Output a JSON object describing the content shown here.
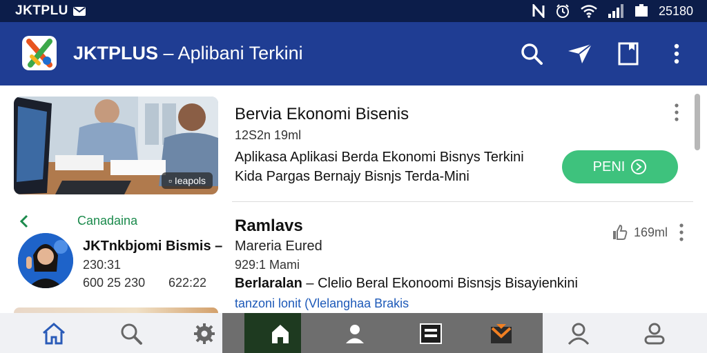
{
  "status_bar": {
    "carrier": "JKTPLU",
    "time": "25180"
  },
  "app_bar": {
    "title_bold": "JKTPLUS",
    "title_rest": " – Aplibani Terkini"
  },
  "card1": {
    "thumbnail_tag": "▫ Ieapols",
    "title": "Bervia  Ekonomi Bisenis",
    "meta": "12S2n 19ml",
    "description_line1": "Aplikasa Aplikasi Berda Ekonomi Bisnys Terkini",
    "description_line2": "Kida Pargas Bernajy Bisnjs Terda-Mini",
    "action_label": "PENI"
  },
  "left_panel": {
    "category": "Canadaina",
    "name": "JKTnkbjomi Bismis –",
    "time": "230:31",
    "number1": "600 25 230",
    "number2": "622:22"
  },
  "card2": {
    "title": "Ramlavs",
    "subtitle": "Mareria Eured",
    "meta": "929:1 Mami",
    "description_bold": "Berlaralan",
    "description_rest": " – Clelio Beral Ekonoomi Bisnsjs Bisayienkini",
    "link_text": "tanzoni lonit  (Vlelanghaa Brakis",
    "like_count": "169ml"
  },
  "icons": [
    "mail-icon",
    "nfc-icon",
    "alarm-icon",
    "wifi-icon",
    "signal-icon",
    "battery-icon",
    "search-icon",
    "send-icon",
    "bookmark-icon",
    "more-vert-icon",
    "home-icon",
    "settings-icon",
    "person-icon",
    "news-icon",
    "inbox-icon",
    "profile-icon"
  ],
  "colors": {
    "status_bar": "#0c1d4a",
    "app_bar": "#1f3d93",
    "accent_green": "#3ec27d",
    "link_blue": "#1d59b8",
    "category_green": "#1b8a4c"
  }
}
